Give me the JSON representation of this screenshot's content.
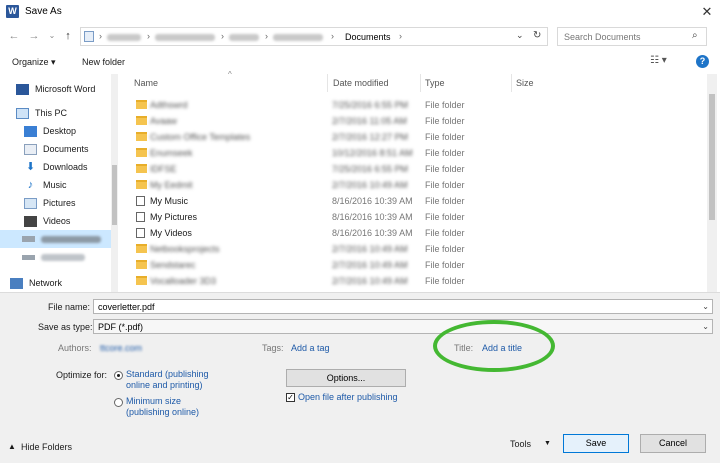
{
  "window": {
    "title": "Save As",
    "app_icon_letter": "W"
  },
  "address": {
    "current_folder": "Documents",
    "search_placeholder": "Search Documents"
  },
  "toolbar": {
    "organize_label": "Organize ▾",
    "new_folder_label": "New folder"
  },
  "nav": {
    "items": [
      {
        "label": "Microsoft Word",
        "icon": "word-icon"
      },
      {
        "label": "This PC",
        "icon": "computer-icon"
      },
      {
        "label": "Desktop",
        "icon": "desktop-icon"
      },
      {
        "label": "Documents",
        "icon": "documents-icon"
      },
      {
        "label": "Downloads",
        "icon": "downloads-icon"
      },
      {
        "label": "Music",
        "icon": "music-icon"
      },
      {
        "label": "Pictures",
        "icon": "pictures-icon"
      },
      {
        "label": "Videos",
        "icon": "videos-icon"
      },
      {
        "label": "Network",
        "icon": "network-icon"
      }
    ]
  },
  "columns": {
    "name": "Name",
    "date": "Date modified",
    "type": "Type",
    "size": "Size"
  },
  "files": [
    {
      "name": "Adthswrd",
      "date": "7/25/2016 6:55 PM",
      "type": "File folder",
      "blurred": true
    },
    {
      "name": "Avaaw",
      "date": "2/7/2016 11:05 AM",
      "type": "File folder",
      "blurred": true
    },
    {
      "name": "Custom Office Templates",
      "date": "2/7/2016 12:27 PM",
      "type": "File folder",
      "blurred": true
    },
    {
      "name": "Enumseek",
      "date": "10/12/2016 8:51 AM",
      "type": "File folder",
      "blurred": true
    },
    {
      "name": "IDFSE",
      "date": "7/25/2016 6:55 PM",
      "type": "File folder",
      "blurred": true
    },
    {
      "name": "My Eedmit",
      "date": "2/7/2016 10:49 AM",
      "type": "File folder",
      "blurred": true
    },
    {
      "name": "My Music",
      "date": "8/16/2016 10:39 AM",
      "type": "File folder",
      "blurred": false
    },
    {
      "name": "My Pictures",
      "date": "8/16/2016 10:39 AM",
      "type": "File folder",
      "blurred": false
    },
    {
      "name": "My Videos",
      "date": "8/16/2016 10:39 AM",
      "type": "File folder",
      "blurred": false
    },
    {
      "name": "Netbooksprojects",
      "date": "2/7/2016 10:49 AM",
      "type": "File folder",
      "blurred": true
    },
    {
      "name": "Sendstarec",
      "date": "2/7/2016 10:49 AM",
      "type": "File folder",
      "blurred": true
    },
    {
      "name": "Vocalloader 3D3",
      "date": "2/7/2016 10:49 AM",
      "type": "File folder",
      "blurred": true
    }
  ],
  "form": {
    "file_name_label": "File name:",
    "file_name_value": "coverletter.pdf",
    "save_type_label": "Save as type:",
    "save_type_value": "PDF (*.pdf)",
    "authors_label": "Authors:",
    "authors_value": "ttcore.com",
    "tags_label": "Tags:",
    "tags_link": "Add a tag",
    "title_label": "Title:",
    "title_link": "Add a title",
    "optimize_label": "Optimize for:",
    "opt_standard": "Standard (publishing online and printing)",
    "opt_minimum": "Minimum size (publishing online)",
    "options_button": "Options...",
    "open_after_label": "Open file after publishing",
    "hide_folders": "Hide Folders",
    "tools_label": "Tools",
    "save_button": "Save",
    "cancel_button": "Cancel"
  },
  "colors": {
    "accent": "#0078d7",
    "highlight_ring": "#44b832",
    "folder": "#f5c44f"
  }
}
